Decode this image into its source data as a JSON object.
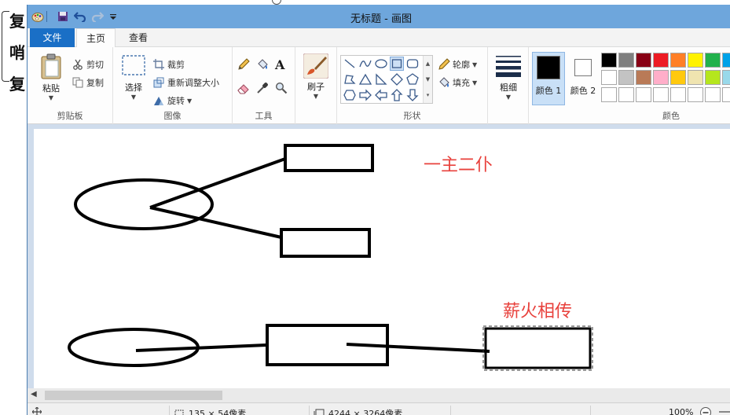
{
  "background_doc": {
    "chars": [
      "复",
      "哨",
      "复"
    ]
  },
  "window": {
    "title": "无标题 - 画图"
  },
  "quick_access": [
    "paint-app-icon",
    "save-icon",
    "undo-icon",
    "redo-icon",
    "customize-qa-icon"
  ],
  "menu": {
    "file": "文件",
    "home": "主页",
    "view": "查看"
  },
  "ribbon": {
    "clipboard": {
      "label": "剪贴板",
      "paste": "粘贴",
      "cut": "剪切",
      "copy": "复制"
    },
    "image": {
      "label": "图像",
      "select": "选择",
      "crop": "裁剪",
      "resize": "重新调整大小",
      "rotate": "旋转"
    },
    "tools": {
      "label": "工具",
      "text_glyph": "A"
    },
    "brushes": {
      "label": "刷子"
    },
    "shapes": {
      "label": "形状",
      "outline": "轮廓",
      "fill": "填充"
    },
    "size": {
      "label": "粗细"
    },
    "colors": {
      "label": "颜色",
      "color1": "颜色 1",
      "color2": "颜色 2",
      "color1_value": "#000000",
      "color2_value": "#ffffff",
      "palette_row1": [
        "#000000",
        "#7f7f7f",
        "#880015",
        "#ed1c24",
        "#ff7f27",
        "#fff200",
        "#22b14c",
        "#00a2e8"
      ],
      "palette_row2": [
        "#ffffff",
        "#c3c3c3",
        "#b97a57",
        "#ffaec9",
        "#ffc90e",
        "#efe4b0",
        "#b5e61d",
        "#99d9ea"
      ],
      "palette_row3": [
        "#ffffff",
        "#ffffff",
        "#ffffff",
        "#ffffff",
        "#ffffff",
        "#ffffff",
        "#ffffff",
        "#ffffff"
      ]
    }
  },
  "canvas": {
    "text1": "一主二仆",
    "text2": "薪火相传",
    "text_color": "#e8413c"
  },
  "status": {
    "selection_size": "135 × 54像素",
    "image_size": "4244 × 3264像素",
    "zoom": "100%"
  }
}
